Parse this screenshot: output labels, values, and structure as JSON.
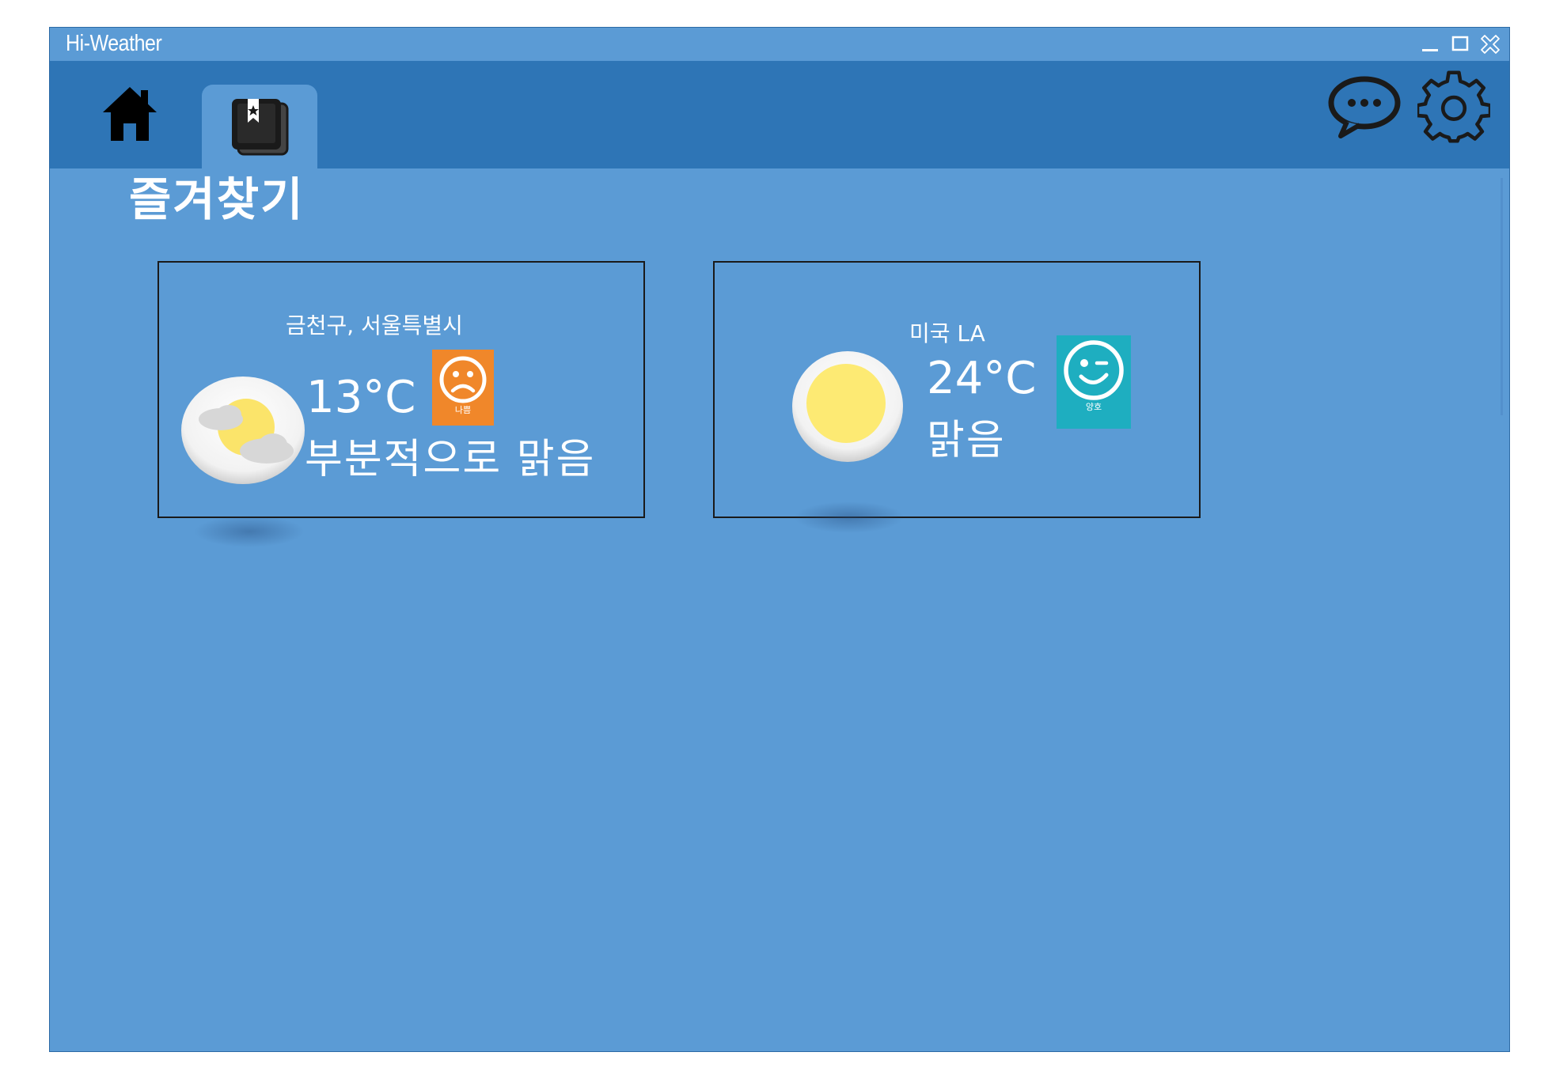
{
  "window": {
    "title": "Hi-Weather"
  },
  "page": {
    "title": "즐겨찾기"
  },
  "nav": {
    "icons": [
      "home-icon",
      "bookmark-icon",
      "chat-icon",
      "gear-icon"
    ]
  },
  "favorites": [
    {
      "location": "금천구, 서울특별시",
      "temperature": "13°C",
      "condition": "부분적으로 맑음",
      "weather_icon": "partly-cloudy-icon",
      "air_quality_label": "나쁨",
      "air_quality_icon": "sad-face-icon",
      "air_quality_color": "#f0872a"
    },
    {
      "location": "미국 LA",
      "temperature": "24°C",
      "condition": "맑음",
      "weather_icon": "sun-icon",
      "air_quality_label": "양호",
      "air_quality_icon": "wink-face-icon",
      "air_quality_color": "#1eaec0"
    }
  ],
  "colors": {
    "background": "#5b9bd5",
    "navbar": "#2e75b6",
    "bad": "#f0872a",
    "good": "#1eaec0"
  }
}
